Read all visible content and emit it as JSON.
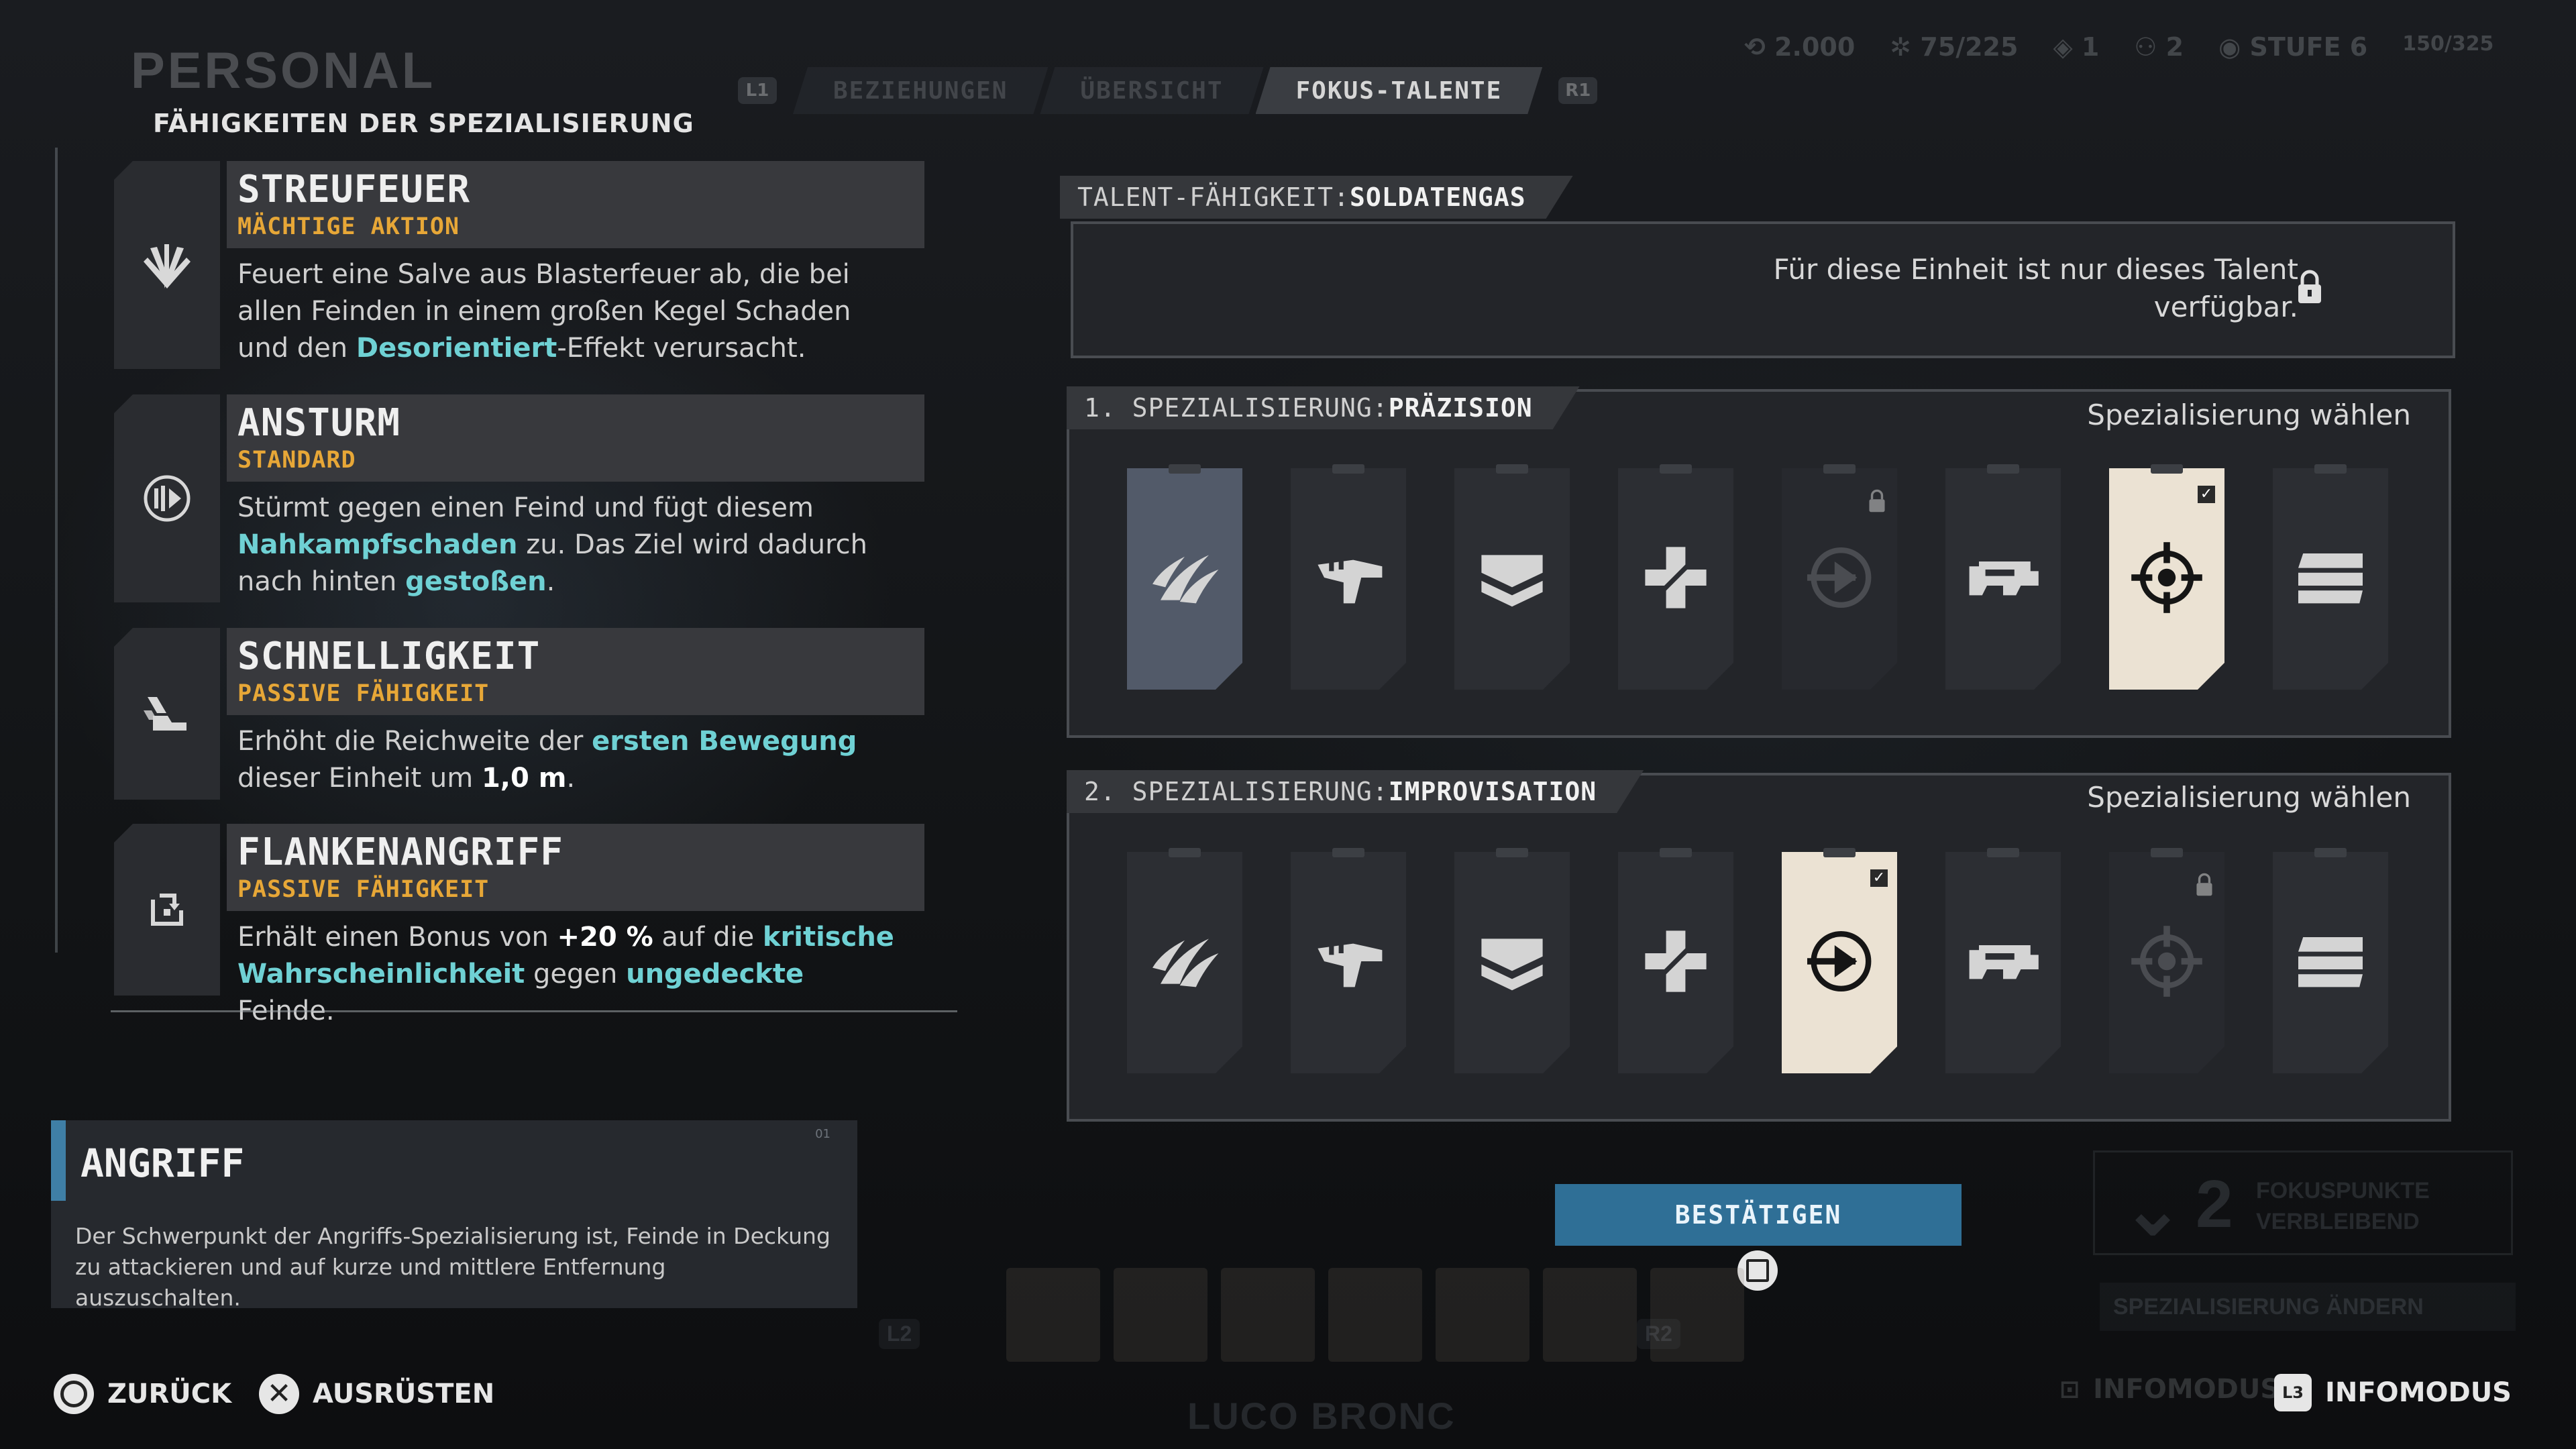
{
  "header": {
    "page_title": "PERSONAL",
    "tabs": [
      {
        "label": "BEZIEHUNGEN",
        "active": false
      },
      {
        "label": "ÜBERSICHT",
        "active": false
      },
      {
        "label": "FOKUS-TALENTE",
        "active": true
      }
    ],
    "bumper_left": "L1",
    "bumper_right": "R1",
    "stats": {
      "credits": "2.000",
      "supplies": "75/225",
      "resource_a": "1",
      "resource_b": "2",
      "level": "STUFE 6",
      "xp": "150/325"
    }
  },
  "left": {
    "section_title": "FÄHIGKEITEN DER SPEZIALISIERUNG",
    "abilities": [
      {
        "name": "STREUFEUER",
        "type": "MÄCHTIGE AKTION",
        "icon": "volley-fire-icon",
        "desc": [
          {
            "t": "Feuert eine Salve aus Blasterfeuer ab, die bei allen Feinden in einem großen Kegel Schaden und den "
          },
          {
            "t": "Desorientiert",
            "h": "hl"
          },
          {
            "t": "-Effekt verursacht."
          }
        ]
      },
      {
        "name": "ANSTURM",
        "type": "STANDARD",
        "icon": "charge-icon",
        "desc": [
          {
            "t": "Stürmt gegen einen Feind und fügt diesem "
          },
          {
            "t": "Nahkampfschaden",
            "h": "hl"
          },
          {
            "t": " zu. Das Ziel wird dadurch nach hinten "
          },
          {
            "t": "gestoßen",
            "h": "hl"
          },
          {
            "t": "."
          }
        ]
      },
      {
        "name": "SCHNELLIGKEIT",
        "type": "PASSIVE FÄHIGKEIT",
        "icon": "speed-boot-icon",
        "desc": [
          {
            "t": "Erhöht die Reichweite der "
          },
          {
            "t": "ersten Bewegung",
            "h": "hl"
          },
          {
            "t": " dieser Einheit um "
          },
          {
            "t": "1,0 m",
            "h": "wh"
          },
          {
            "t": "."
          }
        ]
      },
      {
        "name": "FLANKENANGRIFF",
        "type": "PASSIVE FÄHIGKEIT",
        "icon": "flank-attack-icon",
        "desc": [
          {
            "t": "Erhält einen Bonus von "
          },
          {
            "t": "+20 %",
            "h": "wh"
          },
          {
            "t": " auf die "
          },
          {
            "t": "kritische Wahrscheinlichkeit",
            "h": "hl"
          },
          {
            "t": " gegen "
          },
          {
            "t": "ungedeckte",
            "h": "hl"
          },
          {
            "t": " Feinde."
          }
        ]
      }
    ],
    "angriff": {
      "tag": "01",
      "title": "ANGRIFF",
      "desc": "Der Schwerpunkt der Angriffs-Spezialisierung ist, Feinde in Deckung zu attackieren und auf kurze und mittlere Entfernung auszuschalten."
    }
  },
  "right": {
    "talent": {
      "label_prefix": "TALENT-FÄHIGKEIT: ",
      "label_name": "SOLDATENGAS",
      "notice": "Für diese Einheit ist nur dieses Talent verfügbar."
    },
    "spec1": {
      "label_prefix": "1. SPEZIALISIERUNG: ",
      "label_name": "PRÄZISION",
      "choose": "Spezialisierung wählen",
      "cards": [
        {
          "icon": "claw-slash-icon",
          "state": "hover"
        },
        {
          "icon": "melee-punch-icon",
          "state": "normal"
        },
        {
          "icon": "chevron-rank-icon",
          "state": "normal"
        },
        {
          "icon": "medic-cross-icon",
          "state": "normal"
        },
        {
          "icon": "dash-arrow-icon",
          "state": "locked"
        },
        {
          "icon": "blaster-rifle-icon",
          "state": "normal"
        },
        {
          "icon": "crosshair-icon",
          "state": "selected"
        },
        {
          "icon": "stacked-bars-icon",
          "state": "normal"
        }
      ]
    },
    "spec2": {
      "label_prefix": "2. SPEZIALISIERUNG: ",
      "label_name": "IMPROVISATION",
      "choose": "Spezialisierung wählen",
      "cards": [
        {
          "icon": "claw-slash-icon",
          "state": "normal"
        },
        {
          "icon": "melee-punch-icon",
          "state": "normal"
        },
        {
          "icon": "chevron-rank-icon",
          "state": "normal"
        },
        {
          "icon": "medic-cross-icon",
          "state": "normal"
        },
        {
          "icon": "dash-arrow-icon",
          "state": "selected"
        },
        {
          "icon": "blaster-rifle-icon",
          "state": "normal"
        },
        {
          "icon": "crosshair-icon",
          "state": "locked"
        },
        {
          "icon": "stacked-bars-icon",
          "state": "normal"
        }
      ]
    },
    "confirm_label": "BESTÄTIGEN",
    "focus_points": {
      "value": "2",
      "label": "FOKUSPUNKTE VERBLEIBEND"
    },
    "change_spec": "SPEZIALISIERUNG ÄNDERN"
  },
  "roster": {
    "name": "LUCO BRONC",
    "bumper_left": "L2",
    "bumper_right": "R2"
  },
  "prompts": {
    "back": "ZURÜCK",
    "equip": "AUSRÜSTEN",
    "info_mode_dim": "INFOMODUS",
    "info_mode": "INFOMODUS"
  },
  "colors": {
    "accent_cyan": "#6fd1d4",
    "accent_orange": "#e7a737",
    "confirm_blue": "#2f6f96",
    "selected_card": "#ebe2d3"
  }
}
